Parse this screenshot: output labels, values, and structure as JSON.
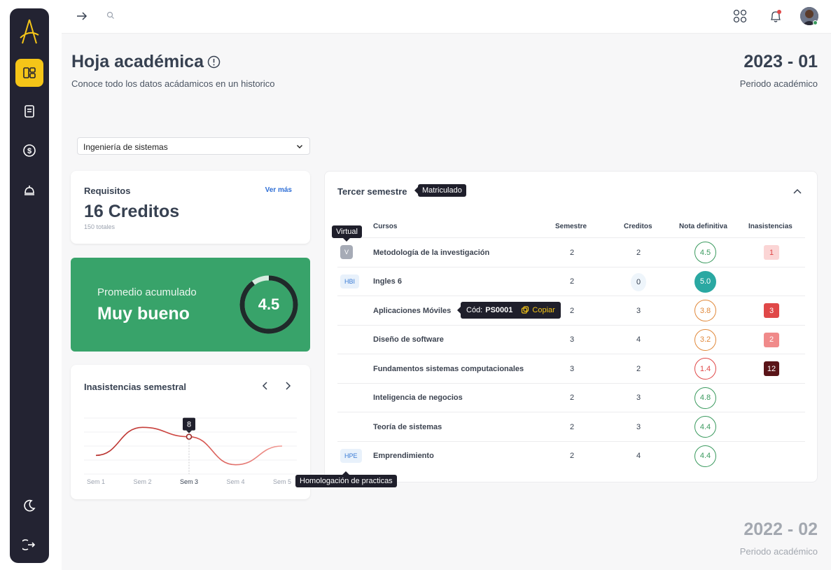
{
  "colors": {
    "sidebar_bg": "#232332",
    "accent": "#f5c518",
    "success": "#38a36a",
    "teal": "#2aa8a2",
    "green_grade": "#3a9a5e",
    "orange_grade": "#e0883a",
    "red_grade": "#e04848",
    "link": "#2f6fd6"
  },
  "sidebar": {
    "logo": "logo-icon",
    "items": [
      {
        "name": "dashboard-icon",
        "active": true
      },
      {
        "name": "document-icon",
        "active": false
      },
      {
        "name": "dollar-icon",
        "active": false
      },
      {
        "name": "bell-service-icon",
        "active": false
      }
    ],
    "bottom": [
      "moon-icon",
      "logout-icon"
    ]
  },
  "topbar": {
    "icons": [
      "arrow-right-icon",
      "search-icon",
      "apps-icon",
      "notification-icon",
      "avatar"
    ]
  },
  "header": {
    "title": "Hoja académica",
    "subtitle": "Conoce todo los datos acádamicos en un historico",
    "period": "2023 - 01",
    "period_label": "Periodo académico"
  },
  "program_select": {
    "value": "Ingeniería de sistemas"
  },
  "requirements": {
    "title": "Requisitos",
    "link": "Ver más",
    "value": "16 Creditos",
    "total": "150 totales"
  },
  "average": {
    "label": "Promedio acumulado",
    "rating": "Muy bueno",
    "value": "4.5",
    "fraction": 0.9
  },
  "absences": {
    "title": "Inasistencias semestral",
    "tooltip": "8"
  },
  "chart_data": {
    "type": "line",
    "title": "Inasistencias semestral",
    "categories": [
      "Sem 1",
      "Sem 2",
      "Sem 3",
      "Sem 4",
      "Sem 5"
    ],
    "series": [
      {
        "values": [
          4,
          10,
          8,
          2,
          6
        ]
      }
    ],
    "highlight": {
      "category": "Sem 3",
      "value": "8"
    },
    "grid": true
  },
  "semester": {
    "title": "Tercer semestre",
    "status": "Matriculado",
    "headers": [
      "Cursos",
      "Semestre",
      "Creditos",
      "Nota definitiva",
      "Inasistencias"
    ],
    "rows": [
      {
        "badge": "V",
        "badge_style": "grey",
        "course": "Metodología de la investigación",
        "semester": "2",
        "credits": "2",
        "grade": "4.5",
        "grade_style": "green",
        "absences": "1",
        "abs_style": "pink"
      },
      {
        "badge": "HBI",
        "badge_style": "blue",
        "course": "Ingles 6",
        "semester": "2",
        "credits": "0",
        "grade": "5.0",
        "grade_style": "teal",
        "absences": "",
        "abs_style": ""
      },
      {
        "badge": "",
        "badge_style": "",
        "course": "Aplicaciones Móviles",
        "semester": "2",
        "credits": "3",
        "grade": "3.8",
        "grade_style": "orange",
        "absences": "3",
        "abs_style": "red"
      },
      {
        "badge": "",
        "badge_style": "",
        "course": "Diseño de software",
        "semester": "3",
        "credits": "4",
        "grade": "3.2",
        "grade_style": "orange",
        "absences": "2",
        "abs_style": "salmon"
      },
      {
        "badge": "",
        "badge_style": "",
        "course": "Fundamentos sistemas computacionales",
        "semester": "3",
        "credits": "2",
        "grade": "1.4",
        "grade_style": "red",
        "absences": "12",
        "abs_style": "dark"
      },
      {
        "badge": "",
        "badge_style": "",
        "course": "Inteligencia de negocios",
        "semester": "2",
        "credits": "3",
        "grade": "4.8",
        "grade_style": "green",
        "absences": "",
        "abs_style": ""
      },
      {
        "badge": "",
        "badge_style": "",
        "course": "Teoría de sistemas",
        "semester": "2",
        "credits": "3",
        "grade": "4.4",
        "grade_style": "green",
        "absences": "",
        "abs_style": ""
      },
      {
        "badge": "HPE",
        "badge_style": "blue",
        "course": "Emprendimiento",
        "semester": "2",
        "credits": "4",
        "grade": "4.4",
        "grade_style": "green",
        "absences": "",
        "abs_style": ""
      }
    ]
  },
  "tooltips": {
    "virtual": "Virtual",
    "code_label": "Cód:",
    "code_value": "PS0001",
    "copy": "Copiar",
    "homologation": "Homologación de practicas"
  },
  "previous_period": {
    "period": "2022 - 02",
    "label": "Periodo académico"
  }
}
